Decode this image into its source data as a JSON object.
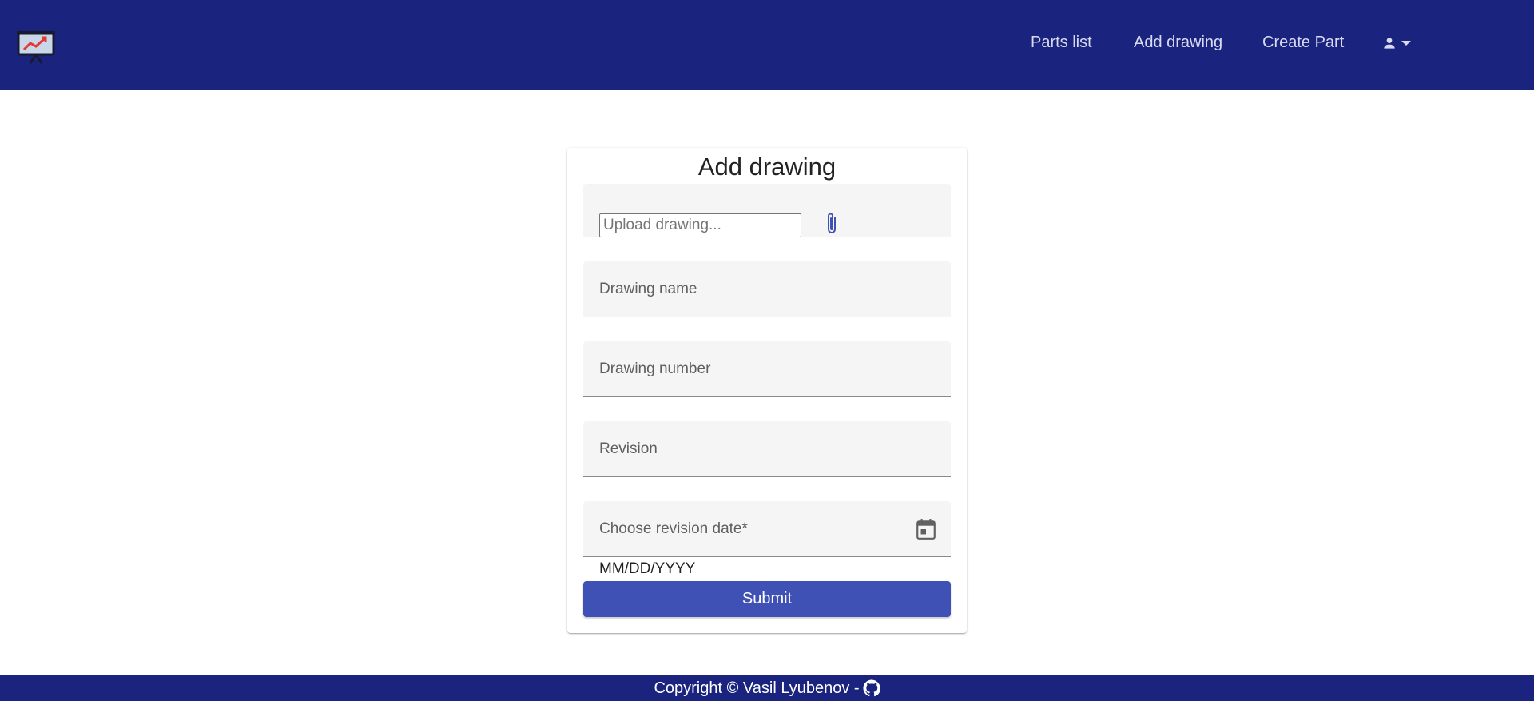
{
  "header": {
    "logo_icon": "presentation-chart-icon",
    "nav": {
      "parts_list": "Parts list",
      "add_drawing": "Add drawing",
      "create_part": "Create Part"
    },
    "user_icon": "person-icon",
    "dropdown_icon": "caret-down-icon"
  },
  "form": {
    "title": "Add drawing",
    "upload": {
      "placeholder": "Upload drawing...",
      "icon": "paperclip-icon"
    },
    "drawing_name": {
      "label": "Drawing name"
    },
    "drawing_number": {
      "label": "Drawing number"
    },
    "revision": {
      "label": "Revision"
    },
    "revision_date": {
      "label": "Choose revision date*",
      "icon": "calendar-icon",
      "hint": "MM/DD/YYYY"
    },
    "submit_label": "Submit"
  },
  "footer": {
    "copyright": "Copyright © Vasil Lyubenov -",
    "icon": "github-icon"
  },
  "colors": {
    "primary_dark": "#1a237e",
    "primary": "#3f51b5",
    "field_bg": "#f5f5f5"
  }
}
